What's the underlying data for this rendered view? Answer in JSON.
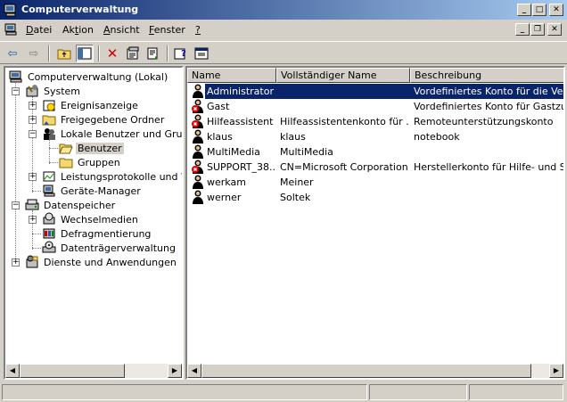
{
  "window": {
    "title": "Computerverwaltung"
  },
  "menu": [
    {
      "pre": "",
      "ul": "D",
      "post": "atei"
    },
    {
      "pre": "Ak",
      "ul": "t",
      "post": "ion"
    },
    {
      "pre": "",
      "ul": "A",
      "post": "nsicht"
    },
    {
      "pre": "",
      "ul": "F",
      "post": "enster"
    },
    {
      "pre": "",
      "ul": "?",
      "post": ""
    }
  ],
  "tree": {
    "root": "Computerverwaltung (Lokal)",
    "system": "System",
    "ereignisanzeige": "Ereignisanzeige",
    "freigegebene_ordner": "Freigegebene Ordner",
    "lokale_benutzer": "Lokale Benutzer und Gruppe",
    "benutzer": "Benutzer",
    "gruppen": "Gruppen",
    "leistungsprotokolle": "Leistungsprotokolle und War",
    "geraete_manager": "Geräte-Manager",
    "datenspeicher": "Datenspeicher",
    "wechselmedien": "Wechselmedien",
    "defragmentierung": "Defragmentierung",
    "datentraeger": "Datenträgerverwaltung",
    "dienste": "Dienste und Anwendungen"
  },
  "columns": {
    "name": "Name",
    "fullname": "Vollständiger Name",
    "description": "Beschreibung"
  },
  "users": [
    {
      "name": "Administrator",
      "fullname": "",
      "description": "Vordefiniertes Konto für die Verwal",
      "disabled": false
    },
    {
      "name": "Gast",
      "fullname": "",
      "description": "Vordefiniertes Konto für Gastzugrif",
      "disabled": true
    },
    {
      "name": "Hilfeassistent",
      "fullname": "Hilfeassistentenkonto für ...",
      "description": "Remoteunterstützungskonto",
      "disabled": true
    },
    {
      "name": "klaus",
      "fullname": "klaus",
      "description": "notebook",
      "disabled": false
    },
    {
      "name": "MultiMedia",
      "fullname": "MultiMedia",
      "description": "",
      "disabled": false
    },
    {
      "name": "SUPPORT_38...",
      "fullname": "CN=Microsoft Corporation...",
      "description": "Herstellerkonto für Hilfe- und Suppo",
      "disabled": true
    },
    {
      "name": "werkam",
      "fullname": "Meiner",
      "description": "",
      "disabled": false
    },
    {
      "name": "werner",
      "fullname": "Soltek",
      "description": "",
      "disabled": false
    }
  ]
}
